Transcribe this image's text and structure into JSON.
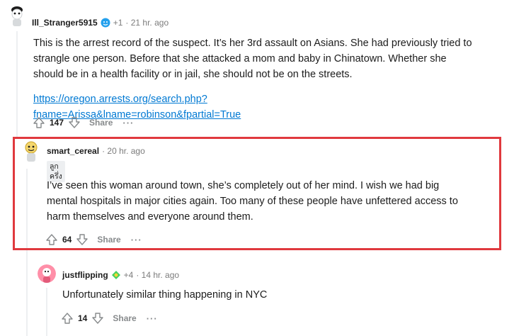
{
  "colors": {
    "highlight": "#e0393e",
    "link": "#0079d3",
    "meta": "#7c7c7c",
    "thread": "#edeff1"
  },
  "comments": [
    {
      "author": "Ill_Stranger5915",
      "award_icon": "wholesome-award-icon",
      "award_count": "+1",
      "time": "· 21 hr. ago",
      "body_lines": [
        "This is the arrest record of the suspect. It’s her 3rd assault on Asians. She had previously tried to",
        "strangle one person. Before that she attacked a mom and baby in Chinatown. Whether she",
        "should be in a health facility or in jail, she should not be on the streets."
      ],
      "link": "https://oregon.arrests.org/search.php?fname=Arissa&lname=robinson&fpartial=True",
      "score": "147",
      "share_label": "Share",
      "more_label": "···"
    },
    {
      "author": "smart_cereal",
      "time": "· 20 hr. ago",
      "flair": "ลูกครึ่ง",
      "body_lines": [
        "I’ve seen this woman around town, she’s completely out of her mind. I wish we had big",
        "mental hospitals in major cities again. Too many of these people have unfettered access to",
        "harm themselves and everyone around them."
      ],
      "score": "64",
      "share_label": "Share",
      "more_label": "···"
    },
    {
      "author": "justflipping",
      "award_icon": "helpful-award-icon",
      "award_count": "+4",
      "time": "· 14 hr. ago",
      "body_lines": [
        "Unfortunately similar thing happening in NYC"
      ],
      "score": "14",
      "share_label": "Share",
      "more_label": "···"
    }
  ]
}
